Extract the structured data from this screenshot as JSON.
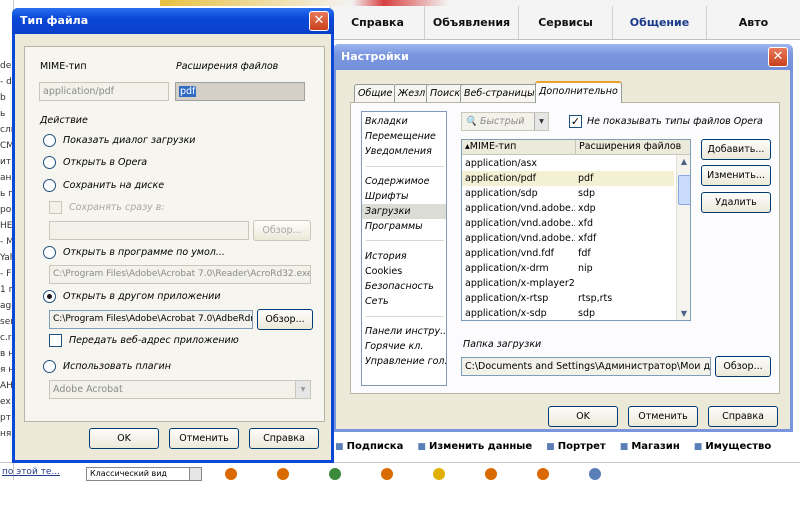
{
  "background": {
    "nav_tabs": [
      "Справка",
      "Объявления",
      "Сервисы",
      "Общение",
      "Авто"
    ],
    "footer_links": [
      "Подписка",
      "Изменить данные",
      "Портрет",
      "Магазин",
      "Имущество"
    ],
    "left_fragments": [
      "dei",
      "- da",
      "b",
      "ь",
      "сли",
      "СМ",
      "ит",
      "анк",
      "ь п",
      "ро",
      "HE",
      "- M",
      "Yah",
      "- F",
      "1 m",
      "age",
      "ser",
      "c.ru",
      "в н",
      "я н",
      "AH",
      "ex",
      "рт",
      "ня"
    ],
    "bottom_link": "по этой те...",
    "bottom_combo": "Классический вид"
  },
  "filetype_dialog": {
    "title": "Тип файла",
    "close_label": "✕",
    "mime_label": "MIME-тип",
    "ext_label": "Расширения файлов",
    "mime_value": "application/pdf",
    "ext_value": "pdf",
    "action_label": "Действие",
    "options": [
      "Показать диалог загрузки",
      "Открыть в Opera",
      "Сохранить на диске"
    ],
    "save_directly_label": "Сохранять сразу в:",
    "browse_label": "Обзор...",
    "open_default_label": "Открыть в программе по умол...",
    "default_app_path": "C:\\Program Files\\Adobe\\Acrobat 7.0\\Reader\\AcroRd32.exe",
    "open_other_label": "Открыть в другом приложении",
    "other_app_path": "C:\\Program Files\\Adobe\\Acrobat 7.0\\AdbeRdr",
    "pass_url_label": "Передать веб-адрес приложению",
    "use_plugin_label": "Использовать плагин",
    "plugin_value": "Adobe Acrobat",
    "ok_label": "OK",
    "cancel_label": "Отменить",
    "help_label": "Справка"
  },
  "settings_dialog": {
    "title": "Настройки",
    "close_label": "✕",
    "tabs": [
      "Общие",
      "Жезл",
      "Поиск",
      "Веб-страницы",
      "Дополнительно"
    ],
    "categories_group1": [
      "Вкладки",
      "Перемещение",
      "Уведомления"
    ],
    "categories_group2": [
      "Содержимое",
      "Шрифты",
      "Загрузки",
      "Программы"
    ],
    "categories_group3": [
      "История",
      "Cookies",
      "Безопасность",
      "Сеть"
    ],
    "categories_group4": [
      "Панели инстру...",
      "Горячие кл.",
      "Управление гол..."
    ],
    "quick_find_placeholder": "Быстрый",
    "hide_opera_types_label": "Не показывать типы файлов Opera",
    "col_mime": "MIME-тип",
    "col_ext": "Расширения файлов",
    "rows": [
      {
        "mime": "application/asx",
        "ext": ""
      },
      {
        "mime": "application/pdf",
        "ext": "pdf"
      },
      {
        "mime": "application/sdp",
        "ext": "sdp"
      },
      {
        "mime": "application/vnd.adobe.x...",
        "ext": "xdp"
      },
      {
        "mime": "application/vnd.adobe.x...",
        "ext": "xfd"
      },
      {
        "mime": "application/vnd.adobe.x...",
        "ext": "xfdf"
      },
      {
        "mime": "application/vnd.fdf",
        "ext": "fdf"
      },
      {
        "mime": "application/x-drm",
        "ext": "nip"
      },
      {
        "mime": "application/x-mplayer2",
        "ext": ""
      },
      {
        "mime": "application/x-rtsp",
        "ext": "rtsp,rts"
      },
      {
        "mime": "application/x-sdp",
        "ext": "sdp"
      }
    ],
    "add_label": "Добавить...",
    "edit_label": "Изменить...",
    "delete_label": "Удалить",
    "download_folder_label": "Папка загрузки",
    "download_path": "C:\\Documents and Settings\\Администратор\\Мои доку",
    "browse_label": "Обзор...",
    "ok_label": "OK",
    "cancel_label": "Отменить",
    "help_label": "Справка"
  }
}
